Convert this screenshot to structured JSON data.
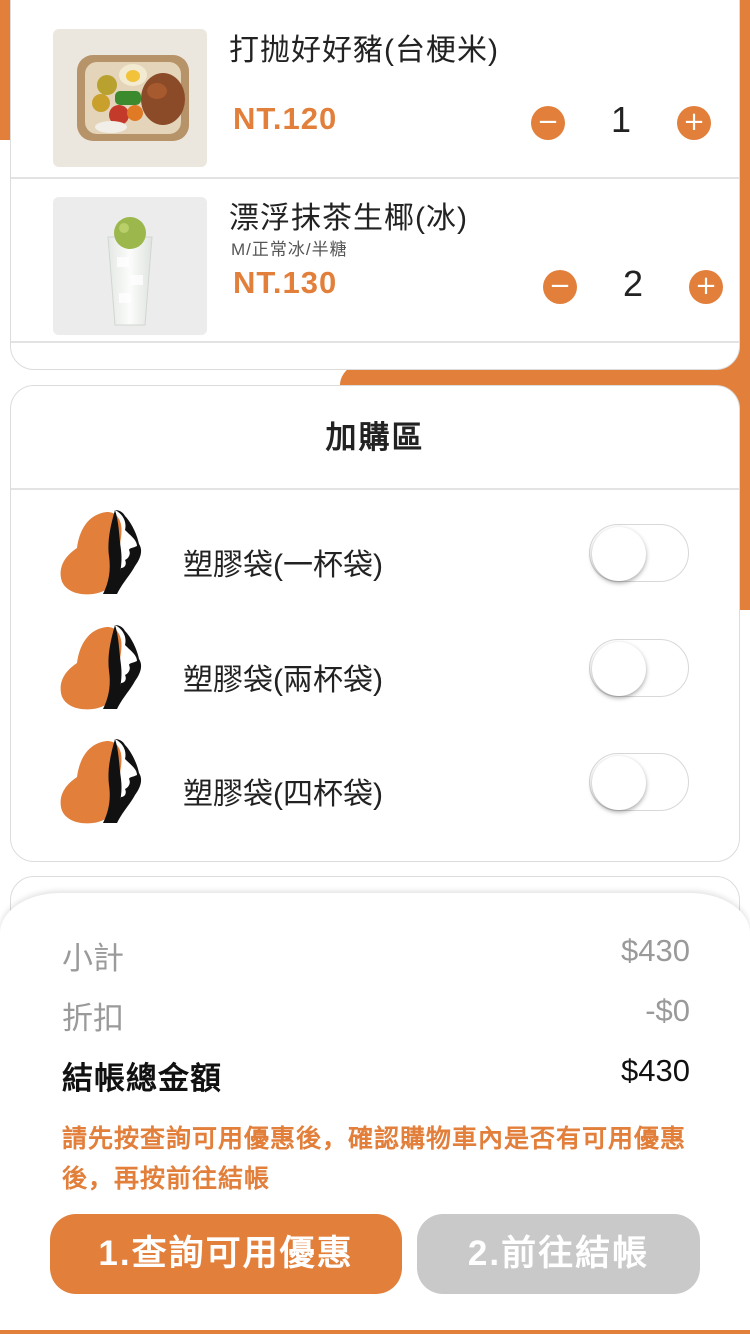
{
  "colors": {
    "accent": "#E27F3B",
    "disabled": "#C9C9C9",
    "muted_text": "#9A9A9A"
  },
  "cart": {
    "items": [
      {
        "name": "打抛好好豬(台梗米)",
        "options": "",
        "price": "NT.120",
        "quantity": "1",
        "minus_icon": "−",
        "plus_icon": "+"
      },
      {
        "name": "漂浮抹茶生椰(冰)",
        "options": "M/正常冰/半糖",
        "price": "NT.130",
        "quantity": "2",
        "minus_icon": "−",
        "plus_icon": "+"
      }
    ]
  },
  "addons": {
    "title": "加購區",
    "items": [
      {
        "label": "塑膠袋(一杯袋)",
        "checked": false
      },
      {
        "label": "塑膠袋(兩杯袋)",
        "checked": false
      },
      {
        "label": "塑膠袋(四杯袋)",
        "checked": false
      }
    ]
  },
  "summary": {
    "subtotal_label": "小計",
    "subtotal_value": "$430",
    "discount_label": "折扣",
    "discount_value": "-$0",
    "total_label": "結帳總金額",
    "total_value": "$430",
    "notice": "請先按查詢可用優惠後，確認購物車內是否有可用優惠後，再按前往結帳",
    "coupon_button": "1.查詢可用優惠",
    "checkout_button": "2.前往結帳"
  }
}
